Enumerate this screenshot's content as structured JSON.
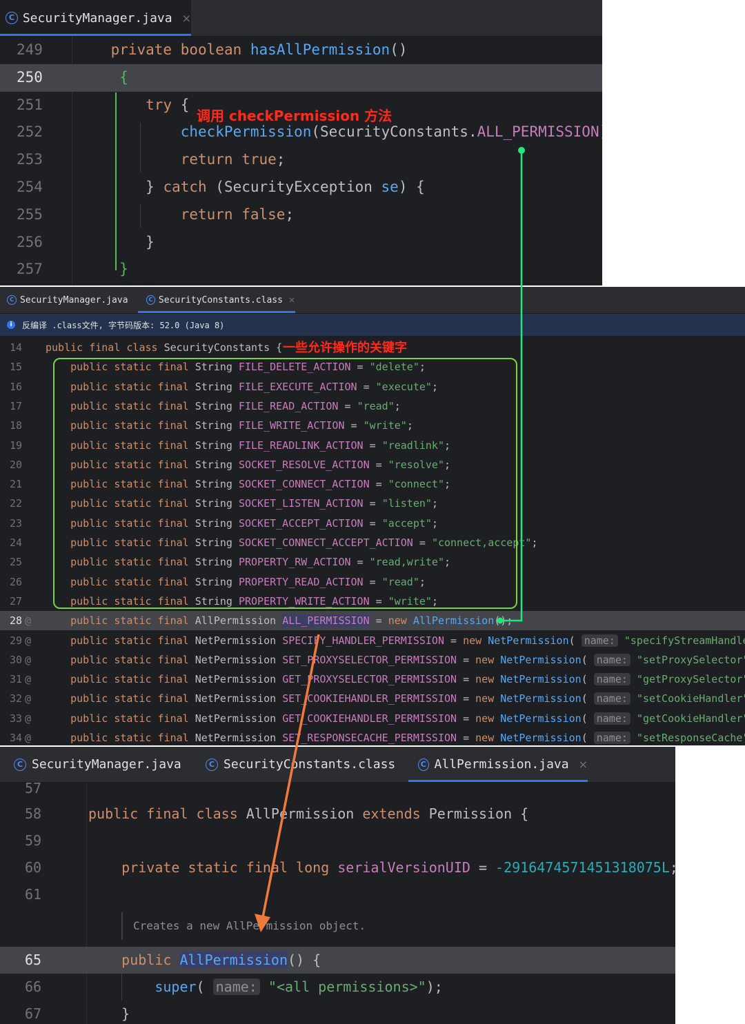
{
  "panel1": {
    "tab": "SecurityManager.java",
    "lines": [
      {
        "n": "249"
      },
      {
        "n": "250"
      },
      {
        "n": "251"
      },
      {
        "n": "252"
      },
      {
        "n": "253"
      },
      {
        "n": "254"
      },
      {
        "n": "255"
      },
      {
        "n": "256"
      },
      {
        "n": "257"
      }
    ],
    "annotation": "调用 checkPermission 方法"
  },
  "panel2": {
    "tabs": [
      "SecurityManager.java",
      "SecurityConstants.class"
    ],
    "info": "反编译 .class文件, 字节码版本: 52.0 (Java 8)",
    "annotation": "一些允许操作的关键字",
    "constants": [
      {
        "n": "15",
        "name": "FILE_DELETE_ACTION",
        "value": "\"delete\""
      },
      {
        "n": "16",
        "name": "FILE_EXECUTE_ACTION",
        "value": "\"execute\""
      },
      {
        "n": "17",
        "name": "FILE_READ_ACTION",
        "value": "\"read\""
      },
      {
        "n": "18",
        "name": "FILE_WRITE_ACTION",
        "value": "\"write\""
      },
      {
        "n": "19",
        "name": "FILE_READLINK_ACTION",
        "value": "\"readlink\""
      },
      {
        "n": "20",
        "name": "SOCKET_RESOLVE_ACTION",
        "value": "\"resolve\""
      },
      {
        "n": "21",
        "name": "SOCKET_CONNECT_ACTION",
        "value": "\"connect\""
      },
      {
        "n": "22",
        "name": "SOCKET_LISTEN_ACTION",
        "value": "\"listen\""
      },
      {
        "n": "23",
        "name": "SOCKET_ACCEPT_ACTION",
        "value": "\"accept\""
      },
      {
        "n": "24",
        "name": "SOCKET_CONNECT_ACCEPT_ACTION",
        "value": "\"connect,accept\""
      },
      {
        "n": "25",
        "name": "PROPERTY_RW_ACTION",
        "value": "\"read,write\""
      },
      {
        "n": "26",
        "name": "PROPERTY_READ_ACTION",
        "value": "\"read\""
      },
      {
        "n": "27",
        "name": "PROPERTY_WRITE_ACTION",
        "value": "\"write\""
      }
    ],
    "permissions": [
      {
        "n": "29",
        "name": "SPECIFY_HANDLER_PERMISSION",
        "arg": "\"specifyStreamHandler\""
      },
      {
        "n": "30",
        "name": "SET_PROXYSELECTOR_PERMISSION",
        "arg": "\"setProxySelector\""
      },
      {
        "n": "31",
        "name": "GET_PROXYSELECTOR_PERMISSION",
        "arg": "\"getProxySelector\""
      },
      {
        "n": "32",
        "name": "SET_COOKIEHANDLER_PERMISSION",
        "arg": "\"setCookieHandler\""
      },
      {
        "n": "33",
        "name": "GET_COOKIEHANDLER_PERMISSION",
        "arg": "\"getCookieHandler\""
      },
      {
        "n": "34",
        "name": "SET_RESPONSECACHE_PERMISSION",
        "arg": "\"setResponseCache\""
      }
    ]
  },
  "panel3": {
    "tabs": [
      "SecurityManager.java",
      "SecurityConstants.class",
      "AllPermission.java"
    ],
    "doc": "Creates a new AllPermission object.",
    "serial": "-2916474571451318075L",
    "super_arg": "\"<all permissions>\""
  },
  "colors": {
    "editor_bg": "#1e1f22",
    "tabbar_bg": "#2b2d30",
    "keyword": "#cf8e6d",
    "constant": "#c77dbb",
    "string": "#6aab73",
    "method": "#56a8f5",
    "annotation_red": "#ff2a1a",
    "green_box": "#7bd43a",
    "green_arrow": "#1ee87a",
    "orange_arrow": "#f07a3a"
  }
}
